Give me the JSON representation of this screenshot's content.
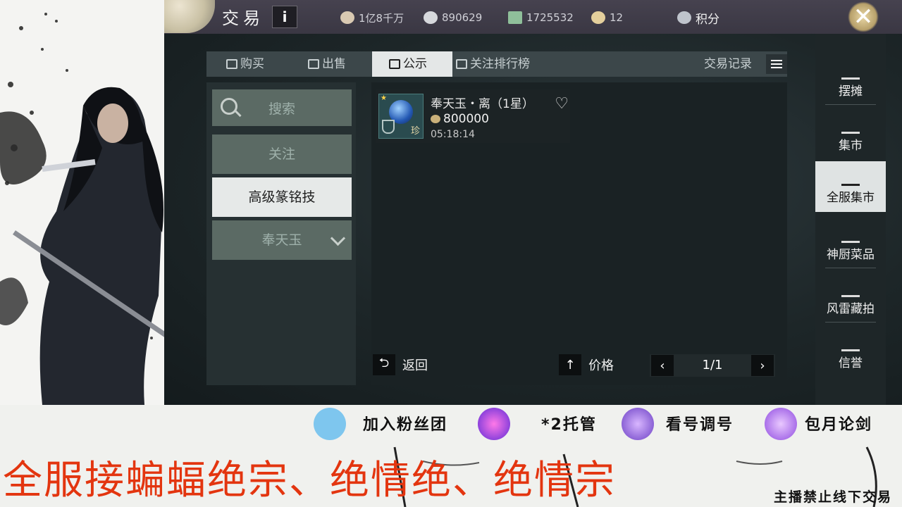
{
  "header": {
    "title": "交易",
    "info_label": "i",
    "resources": [
      {
        "icon": "silver-coins-icon",
        "value": "1亿8千万"
      },
      {
        "icon": "ingot-icon",
        "value": "890629"
      },
      {
        "icon": "jade-ticket-icon",
        "value": "1725532"
      },
      {
        "icon": "gold-ingot-icon",
        "value": "12"
      },
      {
        "icon": "points-badge-icon",
        "value": "积分"
      }
    ],
    "close_label": "✕"
  },
  "tabs": [
    {
      "label": "购买",
      "icon": "buy-icon"
    },
    {
      "label": "出售",
      "icon": "sell-icon"
    },
    {
      "label": "公示",
      "icon": "notice-icon",
      "active": true
    },
    {
      "label": "关注排行榜",
      "icon": "ranking-icon"
    }
  ],
  "trade_record_label": "交易记录",
  "filters": {
    "search_label": "搜索",
    "follow_label": "关注",
    "category_label": "高级篆铭技",
    "subcategory_label": "奉天玉"
  },
  "listing": {
    "items": [
      {
        "name": "奉天玉・离（1星）",
        "price": "800000",
        "time": "05:18:14",
        "rarity": "珍"
      }
    ],
    "back_label": "返回",
    "sort_label": "价格",
    "page": "1/1"
  },
  "side_menu": [
    {
      "label": "摆摊",
      "icon": "stall-icon"
    },
    {
      "label": "集市",
      "icon": "scale-icon"
    },
    {
      "label": "全服集市",
      "icon": "scale-icon",
      "active": true
    },
    {
      "label": "神厨菜品",
      "icon": "kitchen-icon"
    },
    {
      "label": "风雷藏拍",
      "icon": "auction-hammer-icon"
    },
    {
      "label": "信誉",
      "icon": "reputation-icon"
    }
  ],
  "banner": {
    "promos": [
      "加入粉丝团",
      "*2托管",
      "看号调号",
      "包月论剑"
    ],
    "headline": "全服接蝙蝠绝宗、绝情绝、绝情宗",
    "warning": "主播禁止线下交易"
  },
  "colors": {
    "panel_dark": "#1a2224",
    "active_tab_bg": "#e4e7e7",
    "headline_red": "#e3350f"
  }
}
